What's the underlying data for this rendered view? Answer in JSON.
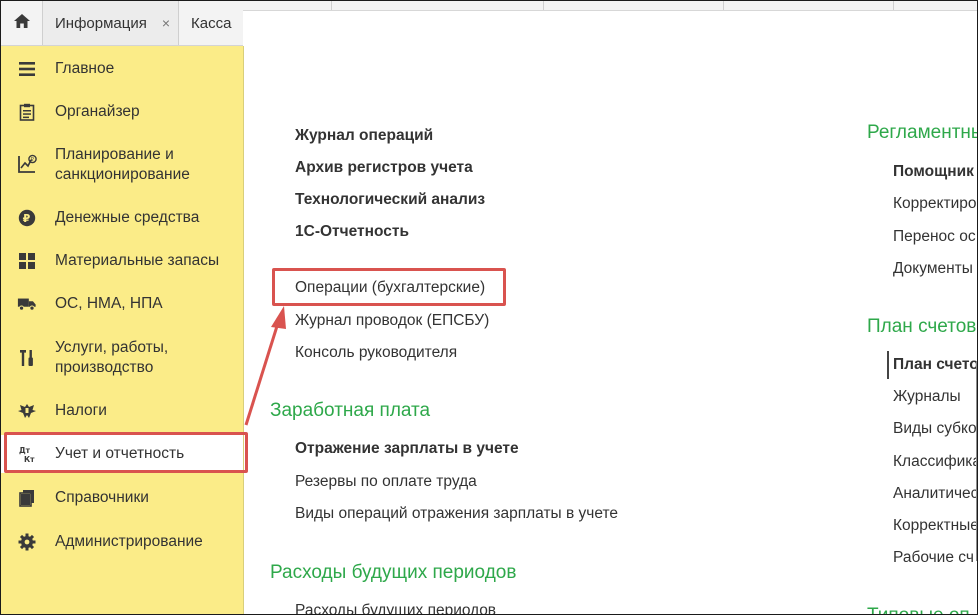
{
  "tabs": {
    "home_icon": "home-icon",
    "info_label": "Информация",
    "info_close": "×",
    "kassa_label": "Касса"
  },
  "sidebar": {
    "items": [
      {
        "label": "Главное",
        "icon": "menu-lines-icon"
      },
      {
        "label": "Органайзер",
        "icon": "clipboard-icon"
      },
      {
        "label": "Планирование и",
        "label2": "санкционирование",
        "icon": "planning-chart-icon"
      },
      {
        "label": "Денежные средства",
        "icon": "ruble-coin-icon"
      },
      {
        "label": "Материальные запасы",
        "icon": "grid-blocks-icon"
      },
      {
        "label": "ОС, НМА, НПА",
        "icon": "truck-icon"
      },
      {
        "label": "Услуги, работы,",
        "label2": "производство",
        "icon": "tools-icon"
      },
      {
        "label": "Налоги",
        "icon": "eagle-emblem-icon"
      },
      {
        "label": "Учет и отчетность",
        "icon": "debit-credit-icon",
        "active": true
      },
      {
        "label": "Справочники",
        "icon": "books-icon"
      },
      {
        "label": "Администрирование",
        "icon": "gear-icon"
      }
    ]
  },
  "main": {
    "col1": {
      "group1": [
        {
          "label": "Журнал операций",
          "bold": true
        },
        {
          "label": "Архив регистров учета",
          "bold": true
        },
        {
          "label": "Технологический анализ",
          "bold": true
        },
        {
          "label": "1С-Отчетность",
          "bold": true
        }
      ],
      "group2": [
        {
          "label": "Операции (бухгалтерские)"
        },
        {
          "label": "Журнал проводок (ЕПСБУ)"
        },
        {
          "label": "Консоль руководителя"
        }
      ],
      "section_salary": "Заработная плата",
      "salary_items": [
        {
          "label": "Отражение зарплаты в учете",
          "bold": true
        },
        {
          "label": "Резервы по оплате труда"
        },
        {
          "label": "Виды операций отражения зарплаты в учете"
        }
      ],
      "section_future": "Расходы будущих периодов",
      "future_items": [
        {
          "label": "Расходы будущих периодов"
        }
      ]
    },
    "col2": {
      "section_reglament": "Регламентны",
      "reglament_items": [
        {
          "label": "Помощник",
          "bold": true
        },
        {
          "label": "Корректиро"
        },
        {
          "label": "Перенос ос"
        },
        {
          "label": "Документы"
        }
      ],
      "section_plan": "План счетов",
      "plan_items": [
        {
          "label": "План счето",
          "bold": true
        },
        {
          "label": "Журналы"
        },
        {
          "label": "Виды субко"
        },
        {
          "label": "Классифика"
        },
        {
          "label": "Аналитичес"
        },
        {
          "label": "Корректные"
        },
        {
          "label": "Рабочие сч"
        }
      ],
      "section_bottom": "Типовые оп"
    }
  },
  "colors": {
    "sidebar_bg": "#fbec88",
    "section_green": "#2ea84a",
    "highlight_red": "#d9534f"
  }
}
